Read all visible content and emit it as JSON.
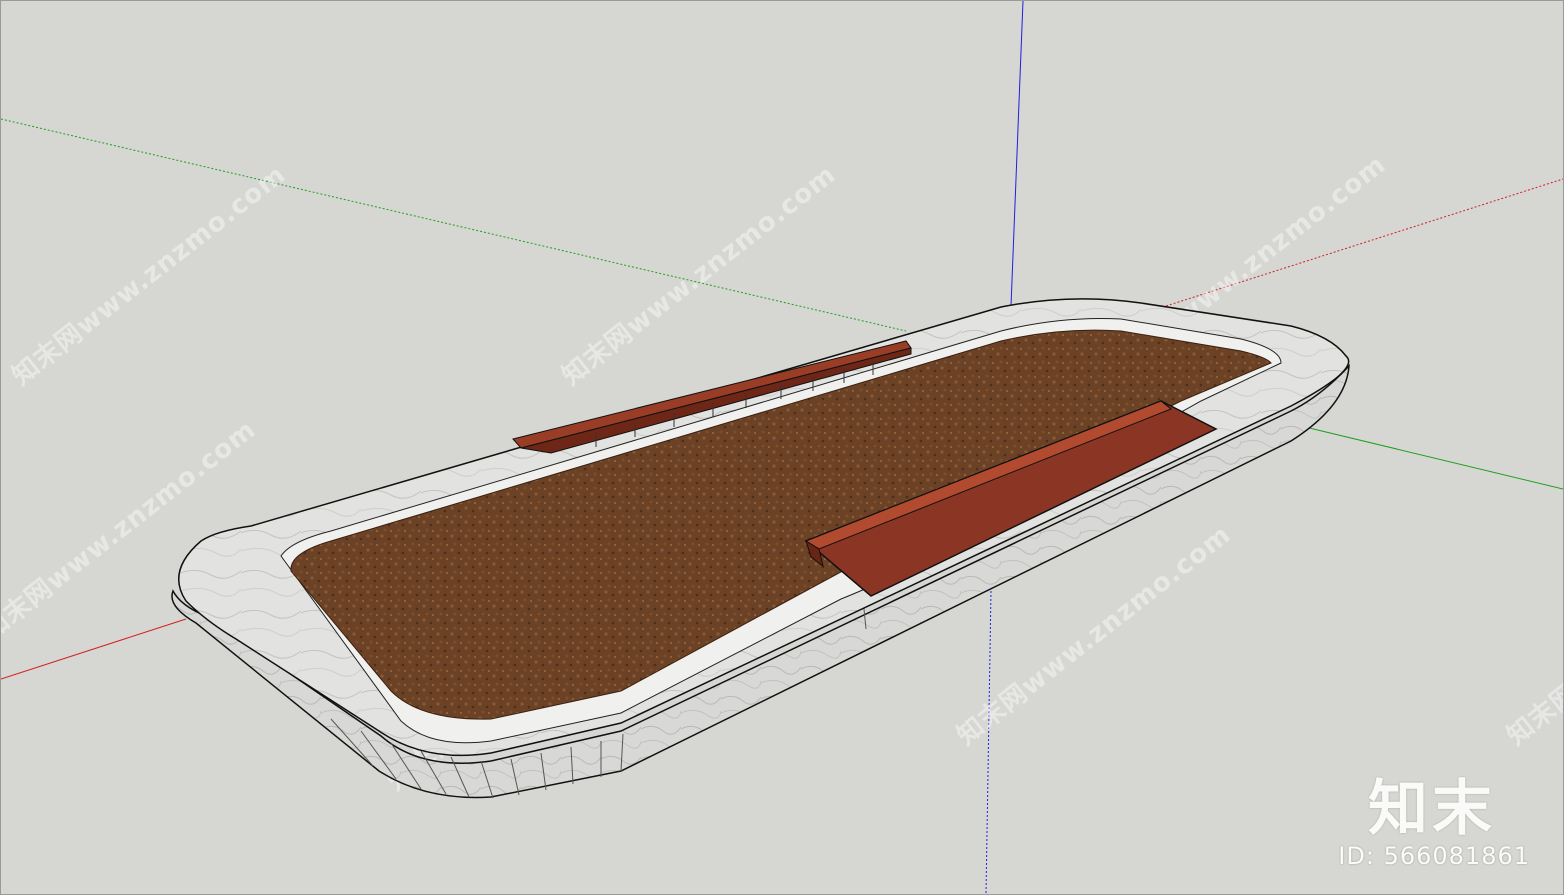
{
  "model": {
    "name": "planter-bench",
    "colors": {
      "background": "#d6d6d2",
      "axis_red": "#d22020",
      "axis_green": "#1ea01e",
      "axis_blue": "#2020e0",
      "marble": "#dcdcda",
      "soil": "#6e4427",
      "wood": "#8b3524"
    }
  },
  "watermark": {
    "text": "知末网www.znzmo.com"
  },
  "brand": {
    "logo_text": "知末",
    "id_text": "ID: 566081861"
  }
}
